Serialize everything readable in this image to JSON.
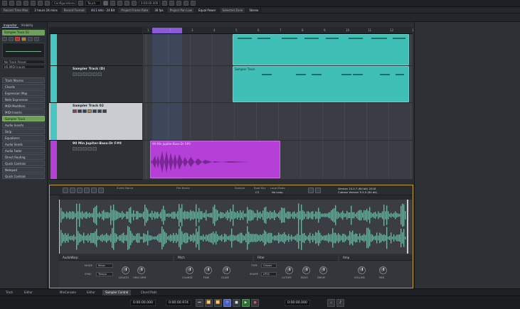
{
  "toolbar": {
    "configurations": "Configurations",
    "touch": "Touch",
    "time_field": "0:00:00.000"
  },
  "infoline": [
    "Record Time Max",
    "2 hours 24 mins",
    "Record Format",
    "44.1 kHz - 24 Bit",
    "Project Frame Rate",
    "30 fps",
    "Project Pan Law",
    "Equal Power",
    "Selected Zone",
    "Stereo"
  ],
  "inspector": {
    "tabs": [
      "Inspector",
      "Visibility"
    ],
    "track_header": "Sampler Track 02",
    "fields": [
      "No Track Preset",
      "HS MIDI Inputs"
    ],
    "sections": [
      {
        "label": "Track Macros",
        "highlight": false
      },
      {
        "label": "Chords",
        "highlight": false
      },
      {
        "label": "Expression Map",
        "highlight": false
      },
      {
        "label": "Note Expression",
        "highlight": false
      },
      {
        "label": "MIDI Modifiers",
        "highlight": false
      },
      {
        "label": "MIDI Inserts",
        "highlight": false
      },
      {
        "label": "Sampler Track",
        "highlight": true
      },
      {
        "label": "Audio Inserts",
        "highlight": false
      },
      {
        "label": "Strip",
        "highlight": false
      },
      {
        "label": "Equalizers",
        "highlight": false
      },
      {
        "label": "Audio Sends",
        "highlight": false
      },
      {
        "label": "Audio Fader",
        "highlight": false
      },
      {
        "label": "Direct Routing",
        "highlight": false
      },
      {
        "label": "Quick Controls",
        "highlight": false
      },
      {
        "label": "Notepad",
        "highlight": false
      },
      {
        "label": "Quick Controls",
        "highlight": false
      }
    ]
  },
  "tracks": [
    {
      "name": "",
      "color": "#46c8c0",
      "selected": false
    },
    {
      "name": "Sampler Track (D)",
      "color": "#46c8c0",
      "selected": false
    },
    {
      "name": "Sampler Track 02",
      "color": "#46c8c0",
      "selected": true
    },
    {
      "name": "90 Min Jupiter-Bass-Dr F#0",
      "color": "#b440d8",
      "selected": false
    }
  ],
  "ruler_ticks": [
    "1",
    "2",
    "3",
    "4",
    "5",
    "6",
    "7",
    "8",
    "9",
    "10",
    "11",
    "12",
    "13"
  ],
  "parts": {
    "part2_title": "Sampler Track",
    "audio_title": "90 Min Jupiter-Bass-Dr F#0"
  },
  "editor": {
    "labels": [
      "Event Name",
      "File Name",
      "Sample",
      "Root Key",
      "Loop Mode"
    ],
    "values": [
      "",
      "",
      "",
      "C3",
      "No Loop"
    ],
    "version": "Version 10.0.7 (64 bit) 2018",
    "version2": "Cubase Version 9.5.0 (64 bit)",
    "sections": [
      "AudioWarp",
      "Pitch",
      "Filter",
      "Amp"
    ],
    "mode_label": "MODE",
    "mode_value": "Music",
    "sync_label": "SYNC",
    "sync_value": "Tempo",
    "type_label": "TYPE",
    "type_value": "Classic",
    "shape_label": "SHAPE",
    "shape_value": "LP24",
    "knobs": [
      "LEGATO",
      "ORIG BPM",
      "COARSE",
      "FINE",
      "GLIDE",
      "CUTOFF",
      "RESO",
      "DRIVE",
      "VOLUME",
      "PAN"
    ]
  },
  "lowerzone_tabs": [
    "Track",
    "Editor",
    "MixConsole",
    "Editor",
    "Sampler Control",
    "Chord Pads"
  ],
  "transport": {
    "left_time": "0:00:00.000",
    "mid_time": "0:00:00.974",
    "right_time": "0:00:00.000"
  }
}
